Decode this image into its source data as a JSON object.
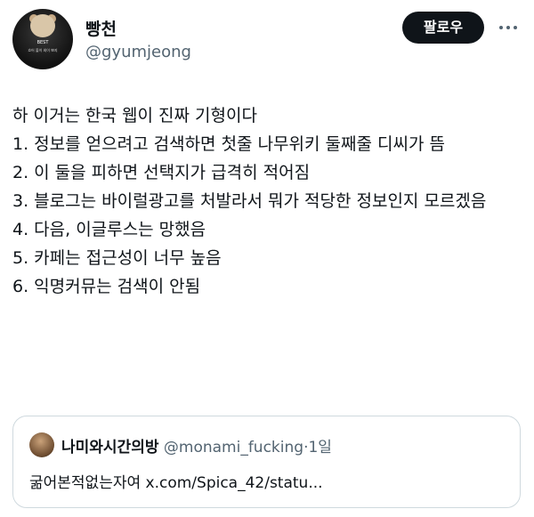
{
  "author": {
    "display_name": "빵천",
    "handle": "@gyumjeong",
    "avatar_caption_top": "BEST",
    "avatar_caption_lines": "흐어 볼이 외이 뽀지"
  },
  "follow_label": "팔로우",
  "more_icon": "more-dots-icon",
  "tweet_lines": [
    "하 이거는 한국 웹이 진짜 기형이다",
    "1. 정보를 얻으려고 검색하면 첫줄 나무위키 둘째줄 디씨가 뜸",
    "2. 이 둘을 피하면 선택지가 급격히 적어짐",
    "3. 블로그는 바이럴광고를 처발라서 뭐가 적당한 정보인지 모르겠음",
    "4. 다음, 이글루스는 망했음",
    "5. 카페는 접근성이 너무 높음",
    "6. 익명커뮤는 검색이 안됨"
  ],
  "quote": {
    "display_name": "나미와시간의방",
    "handle": "@monami_fucking",
    "separator": "·",
    "time": "1일",
    "text": "굶어본적없는자여 x.com/Spica_42/statu..."
  },
  "colors": {
    "text": "#0f1419",
    "muted": "#536471",
    "border": "#cfd9de",
    "button_bg": "#0f1419"
  }
}
